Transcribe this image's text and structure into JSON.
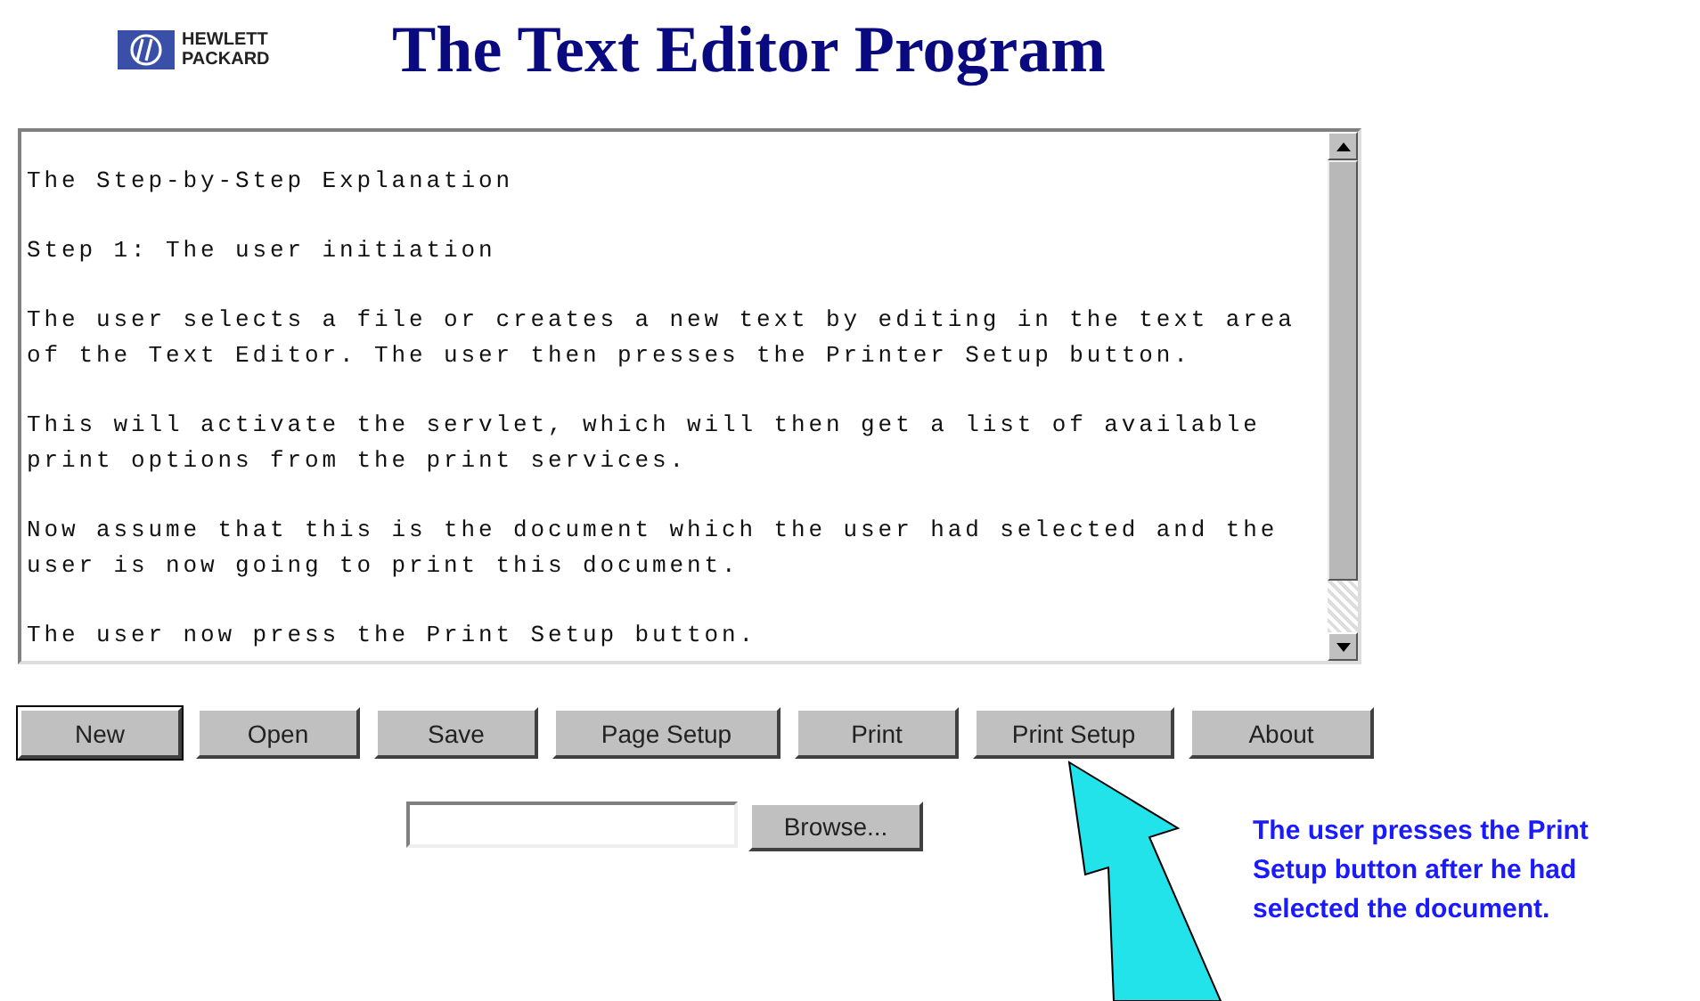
{
  "header": {
    "logo": {
      "lines": [
        "HEWLETT",
        "PACKARD"
      ]
    },
    "title": "The Text Editor Program"
  },
  "text_area": {
    "paragraphs": [
      [
        "The Step-by-Step Explanation"
      ],
      [
        "Step 1: The user initiation"
      ],
      [
        "The user selects a file or creates a new text by editing in the text area",
        "of the Text Editor. The user then presses the Printer Setup button."
      ],
      [
        "This will activate the servlet, which will then get a list of available",
        "print options from the print services."
      ],
      [
        "Now assume that this is the document which the user had selected and the",
        "user is now going to print this document."
      ],
      [
        "The user now press the Print Setup button."
      ]
    ]
  },
  "buttons": [
    {
      "label": "New",
      "kind": "default"
    },
    {
      "label": "Open",
      "kind": "plain"
    },
    {
      "label": "Save",
      "kind": "plain"
    },
    {
      "label": "Page Setup",
      "kind": "plain"
    },
    {
      "label": "Print",
      "kind": "plain"
    },
    {
      "label": "Print Setup",
      "kind": "plain"
    },
    {
      "label": "About",
      "kind": "plain"
    }
  ],
  "file_picker": {
    "button": "Browse..."
  },
  "callout": {
    "text": "The user presses the Print Setup button after he had selected the document."
  }
}
